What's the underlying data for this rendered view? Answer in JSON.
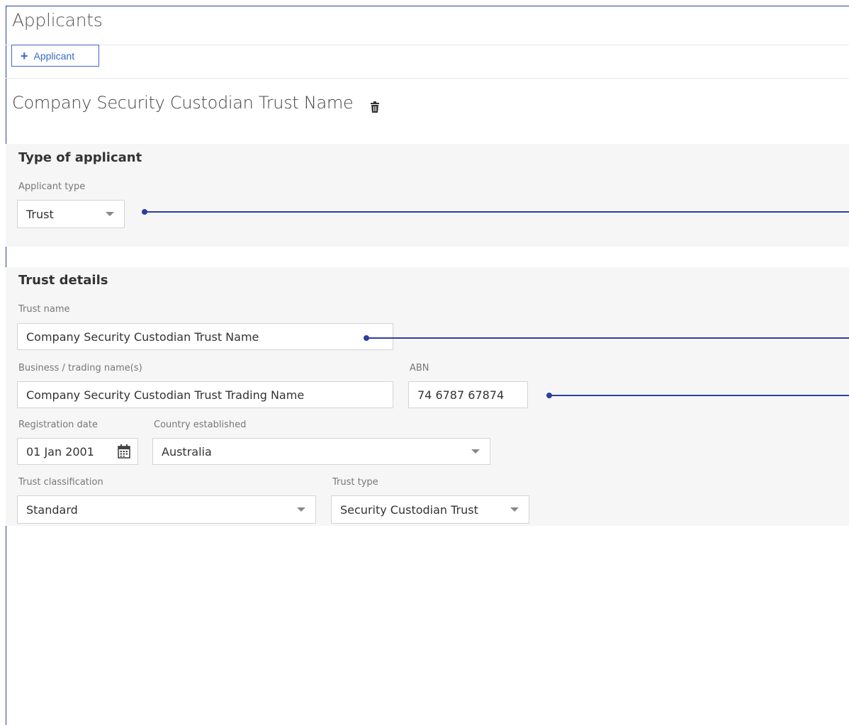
{
  "page": {
    "title": "Applicants"
  },
  "toolbar": {
    "add_applicant_label": "Applicant"
  },
  "applicant": {
    "name": "Company Security Custodian Trust Name"
  },
  "type_section": {
    "heading": "Type of applicant",
    "applicant_type_label": "Applicant type",
    "applicant_type_value": "Trust"
  },
  "trust_section": {
    "heading": "Trust details",
    "trust_name_label": "Trust name",
    "trust_name_value": "Company Security Custodian Trust Name",
    "trading_name_label": "Business / trading name(s)",
    "trading_name_value": "Company Security Custodian Trust Trading Name",
    "abn_label": "ABN",
    "abn_value": "74 6787 67874",
    "registration_date_label": "Registration date",
    "registration_date_value": "01 Jan 2001",
    "country_label": "Country established",
    "country_value": "Australia",
    "classification_label": "Trust classification",
    "classification_value": "Standard",
    "trust_type_label": "Trust type",
    "trust_type_value": "Security Custodian Trust"
  },
  "icons": {
    "add": "plus-icon",
    "delete": "trash-icon",
    "dropdown": "caret-down-icon",
    "date": "calendar-icon"
  },
  "colors": {
    "accent": "#3b6bc4",
    "annotation": "#2d3e9e",
    "panel_bg": "#f6f6f6",
    "border": "#d4d4d4"
  }
}
